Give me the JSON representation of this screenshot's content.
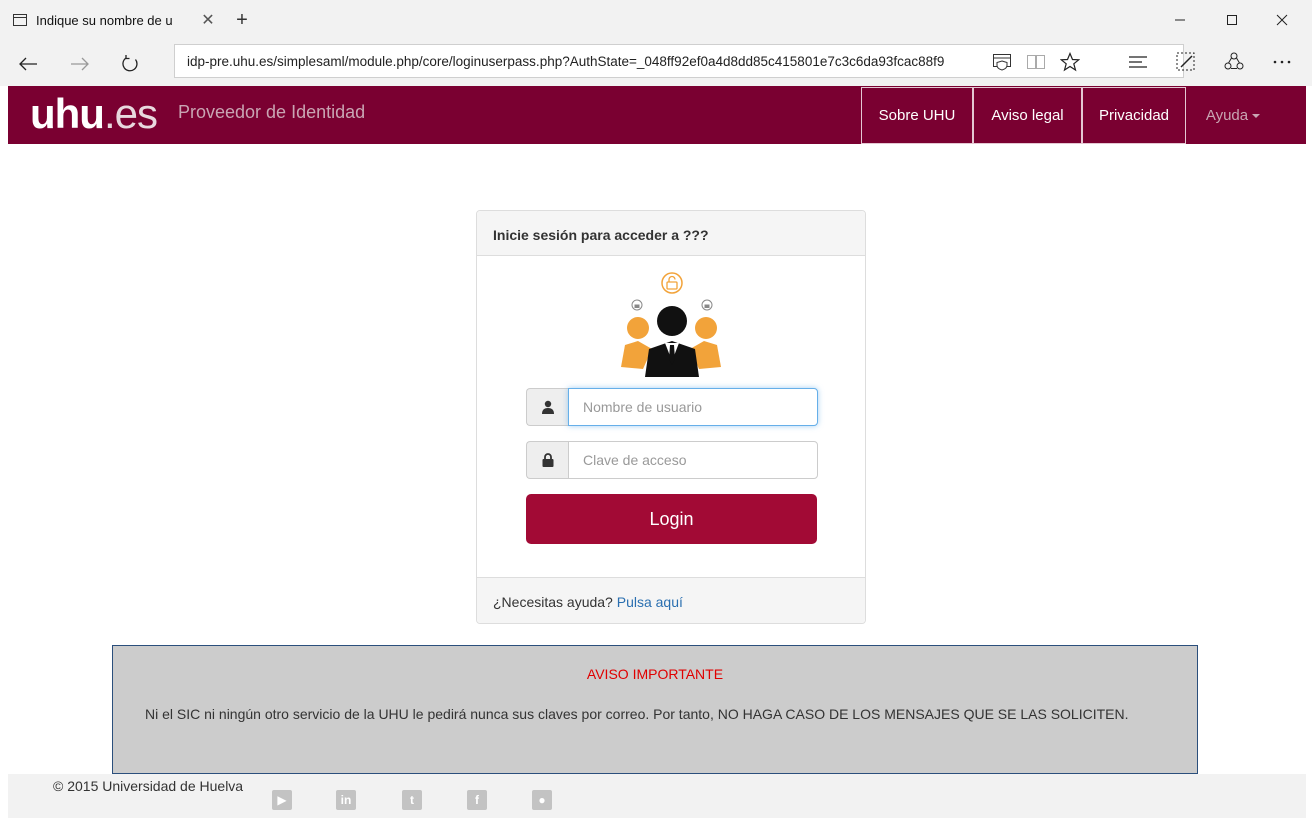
{
  "browser": {
    "tab_title": "Indique su nombre de u",
    "url": "idp-pre.uhu.es/simplesaml/module.php/core/loginuserpass.php?AuthState=_048ff92ef0a4d8dd85c415801e7c3c6da93fcac88f9",
    "icons": [
      "tab-page-icon",
      "close-icon",
      "plus-icon",
      "minimize-icon",
      "maximize-icon",
      "window-close-icon",
      "back-arrow-icon",
      "forward-arrow-icon",
      "refresh-icon",
      "tracking-shield-icon",
      "reading-view-icon",
      "favorite-star-icon",
      "hub-icon",
      "web-note-icon",
      "share-icon",
      "more-icon"
    ]
  },
  "site_nav": {
    "logo_main": "uhu",
    "logo_suffix": ".es",
    "subtitle": "Proveedor de Identidad",
    "links": [
      "Sobre UHU",
      "Aviso legal",
      "Privacidad"
    ],
    "help": "Ayuda",
    "colors": {
      "background": "#7a0031",
      "muted_text": "#c9a5b3"
    }
  },
  "login": {
    "heading": "Inicie sesión para acceder a ???",
    "username_placeholder": "Nombre de usuario",
    "password_placeholder": "Clave de acceso",
    "button_label": "Login",
    "help_text": "¿Necesitas ayuda?",
    "help_link": "Pulsa aquí",
    "colors": {
      "button": "#a20a35",
      "link": "#2a6fb0"
    }
  },
  "notice": {
    "title": "AVISO IMPORTANTE",
    "body": "Ni el SIC ni ningún otro servicio de la UHU le pedirá nunca sus claves por correo. Por tanto, NO HAGA CASO DE LOS MENSAJES QUE SE LAS SOLICITEN.",
    "colors": {
      "title": "#e00000",
      "background": "#cccccc"
    }
  },
  "footer": {
    "copyright": "© 2015 Universidad de Huelva",
    "social": [
      {
        "name": "youtube-icon",
        "glyph": "▶"
      },
      {
        "name": "linkedin-icon",
        "glyph": "in"
      },
      {
        "name": "twitter-icon",
        "glyph": "t"
      },
      {
        "name": "facebook-icon",
        "glyph": "f"
      },
      {
        "name": "globe-icon",
        "glyph": "●"
      }
    ]
  }
}
